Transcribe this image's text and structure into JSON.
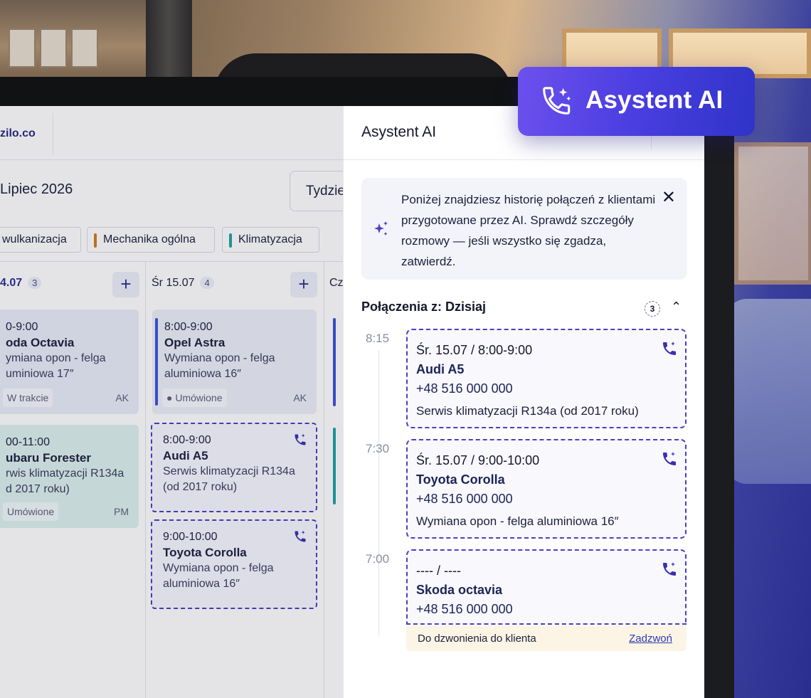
{
  "badge": {
    "label": "Asystent AI",
    "icon": "phone-sparkle-icon"
  },
  "calendar": {
    "brand": "zilo.co",
    "month": "Lipiec 2026",
    "view": "Tydzie",
    "categories": [
      {
        "label": "wulkanizacja",
        "color": "#3f51d8"
      },
      {
        "label": "Mechanika ogólna",
        "color": "#d07a1e"
      },
      {
        "label": "Klimatyzacja",
        "color": "#1ba3a3"
      }
    ],
    "days": [
      {
        "label": "4.07",
        "count": "3"
      },
      {
        "label": "Śr 15.07",
        "count": "4"
      },
      {
        "label": "Cz"
      }
    ],
    "events": {
      "c1": {
        "time": "0-9:00",
        "name": "oda Octavia",
        "desc": "ymiana opon - felga",
        "desc2": "uminiowa 17″",
        "status": "W trakcie",
        "initials": "AK"
      },
      "c2": {
        "time": "00-11:00",
        "name": "ubaru Forester",
        "desc": "rwis klimatyzacji R134a",
        "desc2": "d 2017 roku)",
        "status": "Umówione",
        "initials": "PM"
      },
      "e1": {
        "time": "8:00-9:00",
        "name": "Opel Astra",
        "desc": "Wymiana opon - felga",
        "desc2": "aluminiowa 16″",
        "status": "Umówione",
        "initials": "AK"
      },
      "e2": {
        "time": "8:00-9:00",
        "name": "Audi A5",
        "desc": "Serwis klimatyzacji R134a",
        "desc2": "(od 2017 roku)"
      },
      "e3": {
        "time": "9:00-10:00",
        "name": "Toyota Corolla",
        "desc": "Wymiana opon - felga",
        "desc2": "aluminiowa 16″"
      }
    }
  },
  "panel": {
    "title": "Asystent AI",
    "info": "Poniżej znajdziesz historię połączeń z klientami przygotowane przez AI. Sprawdź szczegóły rozmowy — jeśli wszystko się zgadza, zatwierdź.",
    "section_title": "Połączenia z:  Dzisiaj",
    "section_count": "3",
    "calls": [
      {
        "time": "8:15",
        "slot": "Śr. 15.07 / 8:00-9:00",
        "car": "Audi A5",
        "phone": "+48 516 000 000",
        "service": "Serwis klimatyzacji R134a (od 2017 roku)"
      },
      {
        "time": "7:30",
        "slot": "Śr. 15.07 / 9:00-10:00",
        "car": "Toyota Corolla",
        "phone": "+48 516 000 000",
        "service": "Wymiana opon - felga aluminiowa 16″"
      },
      {
        "time": "7:00",
        "slot": "---- / ----",
        "car": "Skoda octavia",
        "phone": "+48 516 000 000"
      }
    ],
    "todo": {
      "text": "Do dzwonienia do klienta",
      "action": "Zadzwoń"
    }
  }
}
